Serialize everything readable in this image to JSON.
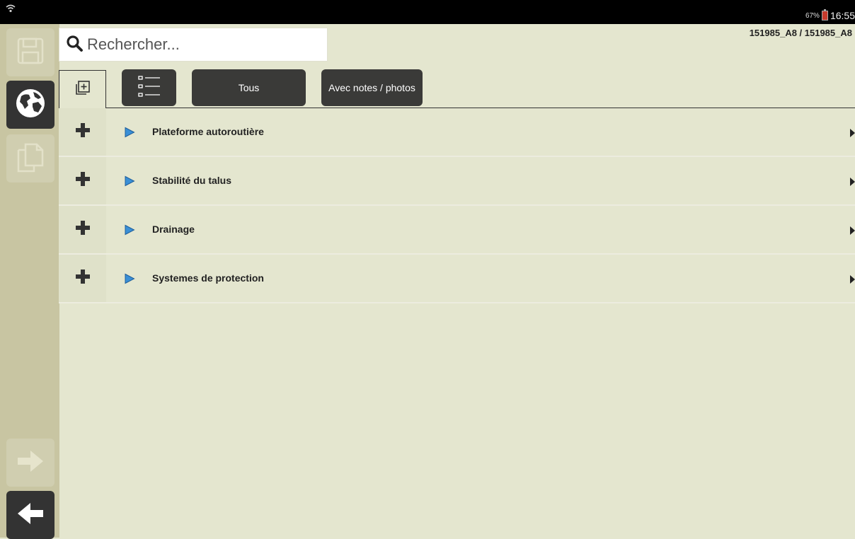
{
  "status_bar": {
    "battery": "67%",
    "time": "16:55"
  },
  "search": {
    "placeholder": "Rechercher..."
  },
  "header": {
    "doc_ref": "151985_A8 / 151985_A8"
  },
  "toolbar": {
    "filter_all": "Tous",
    "filter_notes": "Avec notes / photos"
  },
  "list": {
    "items": [
      {
        "label": "Plateforme autoroutière"
      },
      {
        "label": "Stabilité du talus"
      },
      {
        "label": "Drainage"
      },
      {
        "label": "Systemes de protection"
      }
    ]
  },
  "colors": {
    "background": "#e4e6cf",
    "sidebar": "#c8c5a2",
    "dark_button": "#3a3a38",
    "play_icon": "#3a8fd6"
  },
  "icons": {
    "sidebar": [
      "save-icon",
      "globe-icon",
      "copy-icon",
      "forward-arrow-icon",
      "back-arrow-icon"
    ],
    "row": [
      "plus-icon",
      "play-icon",
      "chevron-right-icon"
    ]
  }
}
